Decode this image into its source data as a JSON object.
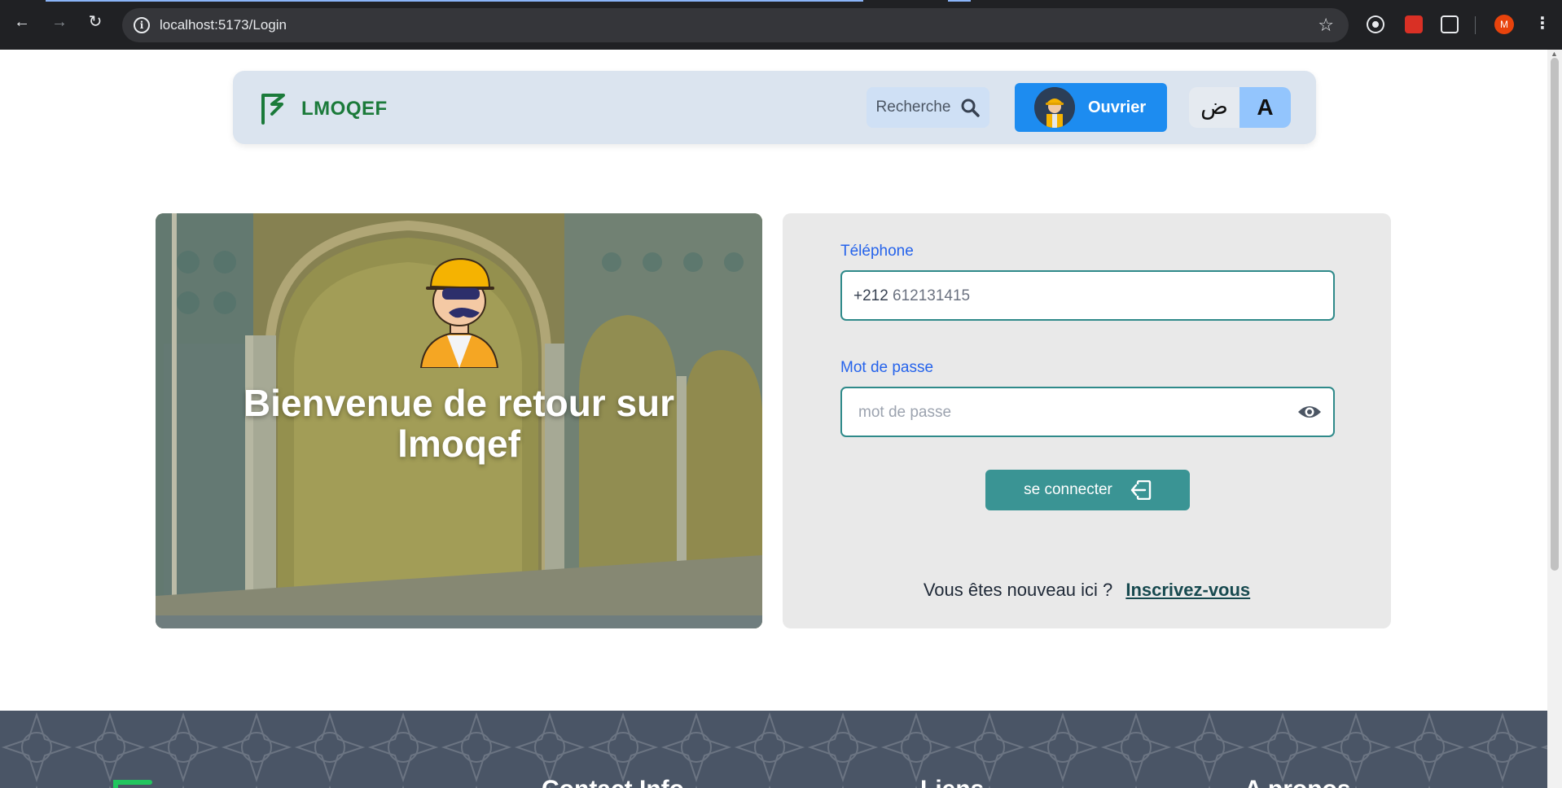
{
  "browser": {
    "url": "localhost:5173/Login",
    "profile_initial": "M"
  },
  "navbar": {
    "brand": "LMOQEF",
    "search_label": "Recherche",
    "role_label": "Ouvrier",
    "lang_arabic": "ض",
    "lang_latin": "A"
  },
  "hero": {
    "title": "Bienvenue de retour sur lmoqef"
  },
  "login": {
    "phone_label": "Téléphone",
    "phone_prefix": "+212",
    "phone_placeholder": "612131415",
    "password_label": "Mot de passe",
    "password_placeholder": "mot de passe",
    "submit_label": "se connecter",
    "signup_prompt": "Vous êtes nouveau ici ?",
    "signup_link": "Inscrivez-vous"
  },
  "footer": {
    "columns": [
      "Contact Info",
      "Liens",
      "A propos"
    ]
  },
  "colors": {
    "brand_green": "#1b7a3a",
    "navbar_bg": "#dbe4ef",
    "role_blue": "#1d8cf0",
    "teal": "#3a9494",
    "label_blue": "#2563eb",
    "footer_bg": "#4a5566"
  },
  "icons": {
    "logo": "lmoqef-logo-icon",
    "search": "search-icon",
    "eye": "eye-icon",
    "login": "login-arrow-icon"
  }
}
